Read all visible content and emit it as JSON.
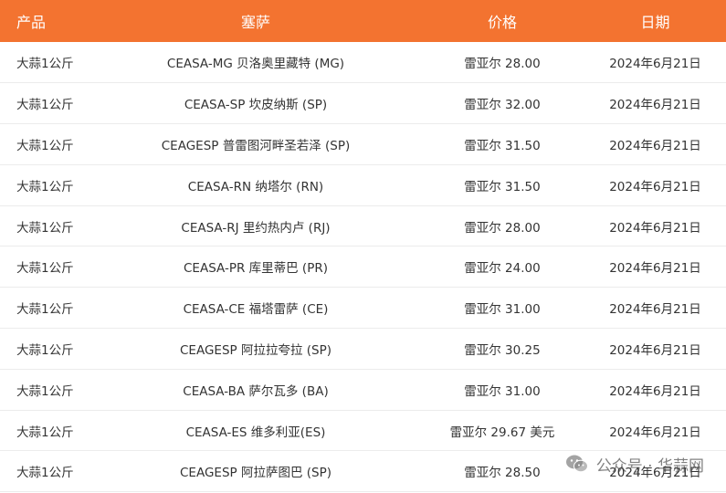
{
  "header": {
    "product": "产品",
    "market": "塞萨",
    "price": "价格",
    "date": "日期"
  },
  "rows": [
    {
      "product": "大蒜1公斤",
      "market": "CEASA-MG 贝洛奥里藏特 (MG)",
      "price": "雷亚尔 28.00",
      "date": "2024年6月21日"
    },
    {
      "product": "大蒜1公斤",
      "market": "CEASA-SP 坎皮纳斯 (SP)",
      "price": "雷亚尔 32.00",
      "date": "2024年6月21日"
    },
    {
      "product": "大蒜1公斤",
      "market": "CEAGESP 普雷图河畔圣若泽 (SP)",
      "price": "雷亚尔 31.50",
      "date": "2024年6月21日"
    },
    {
      "product": "大蒜1公斤",
      "market": "CEASA-RN 纳塔尔 (RN)",
      "price": "雷亚尔 31.50",
      "date": "2024年6月21日"
    },
    {
      "product": "大蒜1公斤",
      "market": "CEASA-RJ 里约热内卢 (RJ)",
      "price": "雷亚尔 28.00",
      "date": "2024年6月21日"
    },
    {
      "product": "大蒜1公斤",
      "market": "CEASA-PR 库里蒂巴 (PR)",
      "price": "雷亚尔 24.00",
      "date": "2024年6月21日"
    },
    {
      "product": "大蒜1公斤",
      "market": "CEASA-CE 福塔雷萨 (CE)",
      "price": "雷亚尔 31.00",
      "date": "2024年6月21日"
    },
    {
      "product": "大蒜1公斤",
      "market": "CEAGESP 阿拉拉夸拉 (SP)",
      "price": "雷亚尔 30.25",
      "date": "2024年6月21日"
    },
    {
      "product": "大蒜1公斤",
      "market": "CEASA-BA 萨尔瓦多 (BA)",
      "price": "雷亚尔 31.00",
      "date": "2024年6月21日"
    },
    {
      "product": "大蒜1公斤",
      "market": "CEASA-ES 维多利亚(ES)",
      "price": "雷亚尔 29.67 美元",
      "date": "2024年6月21日"
    },
    {
      "product": "大蒜1公斤",
      "market": "CEAGESP 阿拉萨图巴 (SP)",
      "price": "雷亚尔 28.50",
      "date": "2024年6月21日"
    }
  ],
  "watermark": {
    "text": "公众号 · 华蒜网",
    "icon": "wechat-icon"
  },
  "colors": {
    "header_bg": "#f37330",
    "header_text": "#ffffff",
    "row_border": "#ececec"
  }
}
